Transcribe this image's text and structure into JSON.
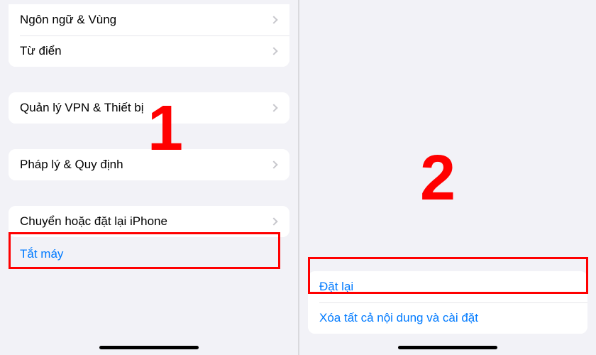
{
  "left": {
    "group1": [
      {
        "label": "Ngôn ngữ & Vùng",
        "chevron": true
      },
      {
        "label": "Từ điển",
        "chevron": true
      }
    ],
    "group2": [
      {
        "label": "Quản lý VPN & Thiết bị",
        "chevron": true
      }
    ],
    "group3": [
      {
        "label": "Pháp lý & Quy định",
        "chevron": true
      }
    ],
    "group4": [
      {
        "label": "Chuyển hoặc đặt lại iPhone",
        "chevron": true
      }
    ],
    "shutdown": "Tắt máy",
    "step": "1"
  },
  "right": {
    "reset": "Đặt lại",
    "erase": "Xóa tất cả nội dung và cài đặt",
    "step": "2"
  }
}
